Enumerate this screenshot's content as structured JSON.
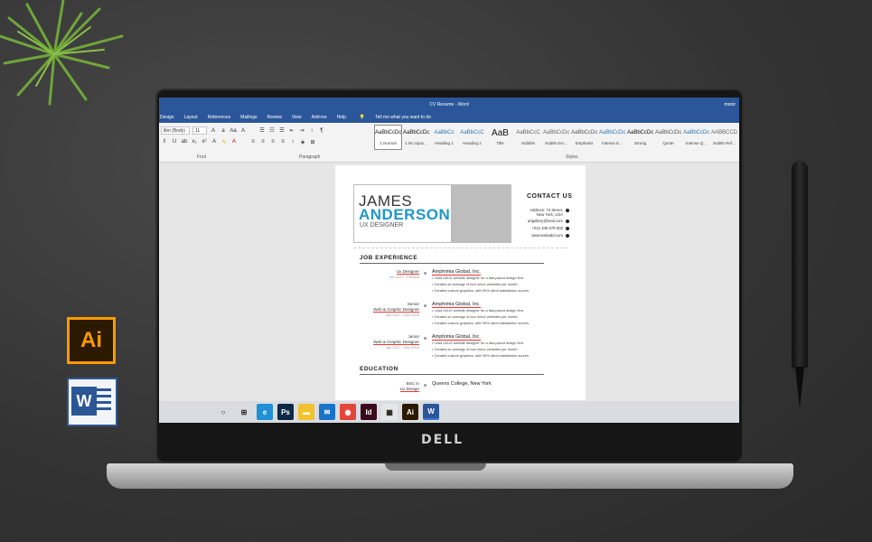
{
  "window": {
    "title": "CV Resume - Word",
    "user": "monir"
  },
  "menu": [
    "Design",
    "Layout",
    "References",
    "Mailings",
    "Review",
    "View",
    "Add-ins",
    "Help"
  ],
  "tell_me": "Tell me what you want to do",
  "ribbon": {
    "font_name": "libri (Body)",
    "font_size": "11",
    "group_font": "Font",
    "group_paragraph": "Paragraph",
    "group_styles": "Styles",
    "styles": [
      {
        "preview": "AaBbCcDc",
        "name": "1 Normal",
        "selected": true
      },
      {
        "preview": "AaBbCcDc",
        "name": "1 No Spac...",
        "selected": false
      },
      {
        "preview": "AaBbCc",
        "name": "Heading 1",
        "selected": false
      },
      {
        "preview": "AaBbCcC",
        "name": "Heading 2",
        "selected": false
      },
      {
        "preview": "AaB",
        "name": "Title",
        "selected": false
      },
      {
        "preview": "AaBbCcC",
        "name": "Subtitle",
        "selected": false
      },
      {
        "preview": "AaBbCcDc",
        "name": "Subtle Em...",
        "selected": false
      },
      {
        "preview": "AaBbCcDc",
        "name": "Emphasis",
        "selected": false
      },
      {
        "preview": "AaBbCcDc",
        "name": "Intense E...",
        "selected": false
      },
      {
        "preview": "AaBbCcDc",
        "name": "Strong",
        "selected": false
      },
      {
        "preview": "AaBbCcDc",
        "name": "Quote",
        "selected": false
      },
      {
        "preview": "AaBbCcDc",
        "name": "Intense Q...",
        "selected": false
      },
      {
        "preview": "AABBCCDC",
        "name": "Subtle Ref...",
        "selected": false
      }
    ]
  },
  "resume": {
    "first_name": "JAMES",
    "last_name": "ANDERSON",
    "role": "UX DESIGNER",
    "contact_heading": "CONTACT US",
    "contact": [
      "Address: 73 Street,",
      "New York, USA",
      "artgallery@mail.com",
      "+012 345 678 502",
      "www.webadd.com"
    ],
    "job_heading": "JOB EXPERIENCE",
    "jobs": [
      {
        "title_lines": [
          "Ux Designer"
        ],
        "dates": "Jan 2017 - Present",
        "company": "Amphimia Global, Inc.",
        "bullets": [
          "Lead UI/UX website designer for a fast-paced design firm.",
          "Created an average of four minor websites per month.",
          "Created custom graphics, with 99% client satisfaction scores."
        ]
      },
      {
        "title_lines": [
          "Senior",
          "Web & Graphic Designer"
        ],
        "dates": "Jan 2017 - Dec 2018",
        "company": "Amphimia Global, Inc.",
        "bullets": [
          "Lead UI/UX website designer for a fast-paced design firm.",
          "Created an average of four minor websites per month.",
          "Created custom graphics, with 99% client satisfaction scores."
        ]
      },
      {
        "title_lines": [
          "Junior",
          "Web & Graphic Designer"
        ],
        "dates": "Jan 2017 - Dec 2018",
        "company": "Amphimia Global, Inc.",
        "bullets": [
          "Lead UI/UX website designer for a fast-paced design firm.",
          "Created an average of four minor websites per month.",
          "Created custom graphics, with 99% client satisfaction scores."
        ]
      }
    ],
    "education_heading": "EDUCATION",
    "education": {
      "degree_lines": [
        "BSC in",
        "Ux Design"
      ],
      "school": "Queens College, New York"
    }
  },
  "laptop_brand": "DELL",
  "side_icons": {
    "illustrator": "Ai",
    "word": "W"
  },
  "taskbar": [
    {
      "name": "cortana-icon",
      "glyph": "○",
      "color": "#d9dce0"
    },
    {
      "name": "task-view-icon",
      "glyph": "⊞",
      "color": "#d9dce0"
    },
    {
      "name": "edge-icon",
      "glyph": "e",
      "color": "#1f8fd6"
    },
    {
      "name": "photoshop-icon",
      "glyph": "Ps",
      "color": "#0d2a45"
    },
    {
      "name": "file-explorer-icon",
      "glyph": "▬",
      "color": "#f2c12e"
    },
    {
      "name": "mail-icon",
      "glyph": "✉",
      "color": "#1a73c9"
    },
    {
      "name": "chrome-icon",
      "glyph": "◉",
      "color": "#e4463a"
    },
    {
      "name": "indesign-icon",
      "glyph": "Id",
      "color": "#3b0a1c"
    },
    {
      "name": "store-icon",
      "glyph": "▦",
      "color": "#e6e6e6"
    },
    {
      "name": "illustrator-icon",
      "glyph": "Ai",
      "color": "#2b1a00"
    },
    {
      "name": "word-icon",
      "glyph": "W",
      "color": "#2b579a"
    }
  ]
}
